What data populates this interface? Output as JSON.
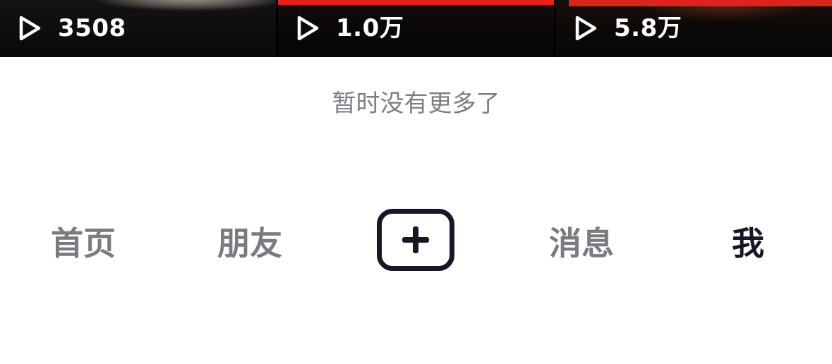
{
  "videos": [
    {
      "play_count": "3508",
      "icon": "play-icon"
    },
    {
      "play_count": "1.0万",
      "icon": "play-icon"
    },
    {
      "play_count": "5.8万",
      "icon": "play-icon"
    }
  ],
  "end_message": "暂时没有更多了",
  "tab_bar": {
    "home_label": "首页",
    "friends_label": "朋友",
    "create_icon": "plus-icon",
    "messages_label": "消息",
    "me_label": "我",
    "active_tab": "我"
  },
  "colors": {
    "active_tab": "#161823",
    "inactive_tab": "#7a7a80",
    "end_message": "#7d7d83",
    "accent_red": "#e8201c"
  }
}
